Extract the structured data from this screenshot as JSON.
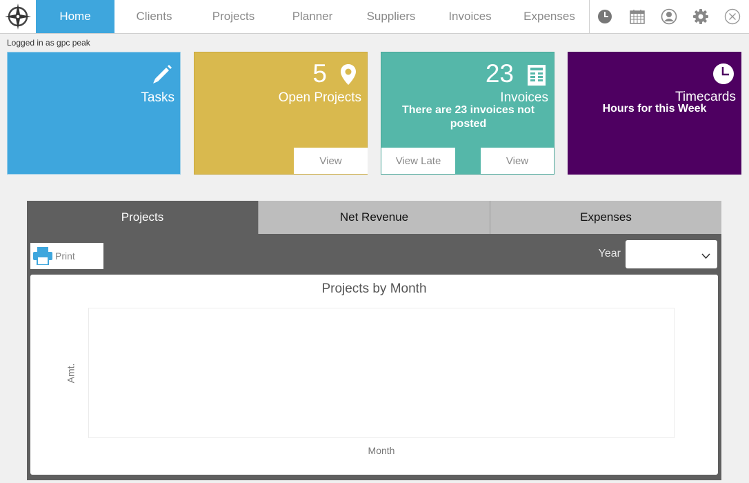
{
  "nav": {
    "items": [
      {
        "label": "Home",
        "active": true
      },
      {
        "label": "Clients",
        "active": false
      },
      {
        "label": "Projects",
        "active": false
      },
      {
        "label": "Planner",
        "active": false
      },
      {
        "label": "Suppliers",
        "active": false
      },
      {
        "label": "Invoices",
        "active": false
      },
      {
        "label": "Expenses",
        "active": false
      }
    ],
    "tools": [
      "clock-icon",
      "calendar-icon",
      "user-icon",
      "gear-icon",
      "close-icon"
    ]
  },
  "session": {
    "logged_in_text": "Logged in as gpc peak"
  },
  "cards": {
    "tasks": {
      "title": "Tasks",
      "color": "#3ea6dd"
    },
    "projects": {
      "count": "5",
      "title": "Open Projects",
      "view_label": "View",
      "color": "#d9b94e"
    },
    "invoices": {
      "count": "23",
      "title": "Invoices",
      "subtitle": "There are 23 invoices not posted",
      "view_late_label": "View Late",
      "view_label": "View",
      "color": "#55b7a9"
    },
    "timecards": {
      "title": "Timecards",
      "subtitle": "Hours for this Week",
      "color": "#4e0061"
    }
  },
  "panel": {
    "tabs": [
      {
        "label": "Projects",
        "active": true
      },
      {
        "label": "Net Revenue",
        "active": false
      },
      {
        "label": "Expenses",
        "active": false
      }
    ],
    "print_label": "Print",
    "year_label": "Year",
    "year_value": ""
  },
  "chart_data": {
    "type": "bar",
    "title": "Projects by Month",
    "xlabel": "Month",
    "ylabel": "Amt.",
    "categories": [],
    "values": []
  }
}
